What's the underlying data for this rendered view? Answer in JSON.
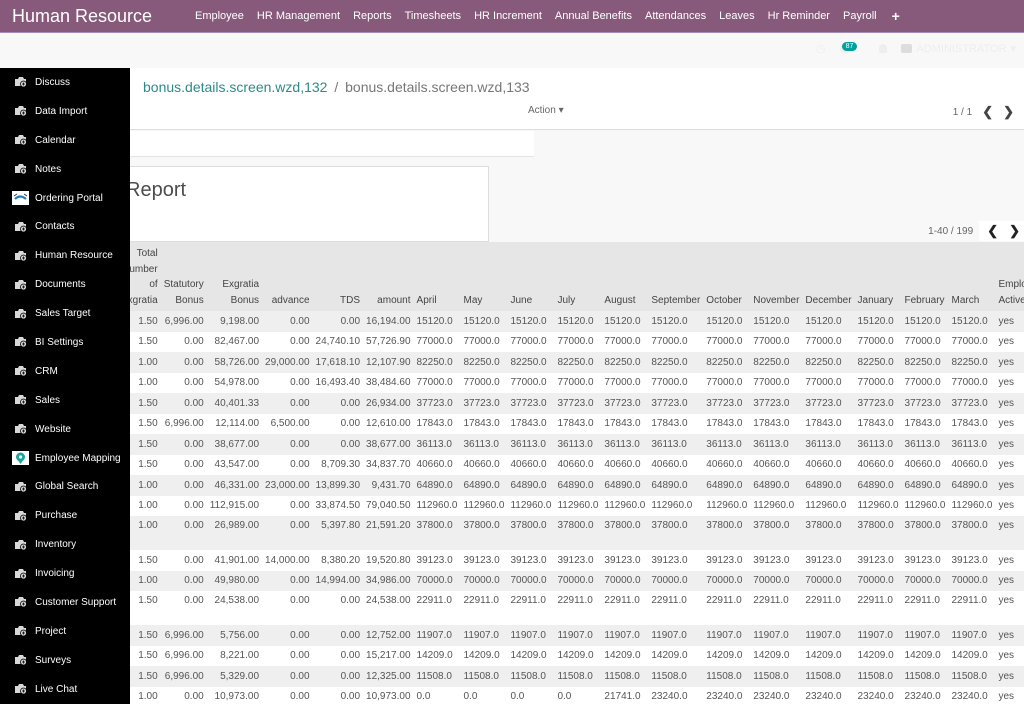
{
  "app": {
    "brand": "Human Resource",
    "menu": [
      "Employee",
      "HR Management",
      "Reports",
      "Timesheets",
      "HR Increment",
      "Annual Benefits",
      "Attendances",
      "Leaves",
      "Hr Reminder",
      "Payroll"
    ],
    "plus_icon": "+",
    "systray": {
      "clock_icon": "◷",
      "messages_icon": "💬",
      "message_count": "87",
      "bell_icon": "🔔",
      "user_name": "ADMINISTRATOR",
      "caret": "▾"
    }
  },
  "sidebar": {
    "items": [
      {
        "label": "Discuss",
        "icon": "default-app-icon"
      },
      {
        "label": "Data Import",
        "icon": "default-app-icon"
      },
      {
        "label": "Calendar",
        "icon": "default-app-icon"
      },
      {
        "label": "Notes",
        "icon": "default-app-icon"
      },
      {
        "label": "Ordering Portal",
        "icon": "handshake-icon"
      },
      {
        "label": "Contacts",
        "icon": "default-app-icon"
      },
      {
        "label": "Human Resource",
        "icon": "default-app-icon"
      },
      {
        "label": "Documents",
        "icon": "default-app-icon"
      },
      {
        "label": "Sales Target",
        "icon": "default-app-icon"
      },
      {
        "label": "BI Settings",
        "icon": "default-app-icon"
      },
      {
        "label": "CRM",
        "icon": "default-app-icon"
      },
      {
        "label": "Sales",
        "icon": "default-app-icon"
      },
      {
        "label": "Website",
        "icon": "default-app-icon"
      },
      {
        "label": "Employee Mapping",
        "icon": "map-pin-icon"
      },
      {
        "label": "Global Search",
        "icon": "default-app-icon"
      },
      {
        "label": "Purchase",
        "icon": "default-app-icon"
      },
      {
        "label": "Inventory",
        "icon": "default-app-icon"
      },
      {
        "label": "Invoicing",
        "icon": "default-app-icon"
      },
      {
        "label": "Customer Support",
        "icon": "default-app-icon"
      },
      {
        "label": "Project",
        "icon": "default-app-icon"
      },
      {
        "label": "Surveys",
        "icon": "default-app-icon"
      },
      {
        "label": "Live Chat",
        "icon": "default-app-icon"
      }
    ]
  },
  "control_panel": {
    "breadcrumb_link": "bonus.details.screen.wzd,132",
    "breadcrumb_sep": "/",
    "breadcrumb_current": "bonus.details.screen.wzd,133",
    "action_label": "Action ▾",
    "pager": "1 / 1",
    "prev": "❮",
    "next": "❯"
  },
  "sheet": {
    "title": "Report"
  },
  "list": {
    "pager": "1-40 / 199",
    "prev": "❮",
    "next": "❯",
    "columns": [
      {
        "label": "Total\nNumber\nof\nExgratia",
        "align": "num"
      },
      {
        "label": "Statutory\nBonus",
        "align": "num"
      },
      {
        "label": "Exgratia\nBonus",
        "align": "num"
      },
      {
        "label": "advance",
        "align": "num"
      },
      {
        "label": "TDS",
        "align": "num"
      },
      {
        "label": "amount",
        "align": "num"
      },
      {
        "label": "April",
        "align": "txt"
      },
      {
        "label": "May",
        "align": "txt"
      },
      {
        "label": "June",
        "align": "txt"
      },
      {
        "label": "July",
        "align": "txt"
      },
      {
        "label": "August",
        "align": "txt"
      },
      {
        "label": "September",
        "align": "txt"
      },
      {
        "label": "October",
        "align": "txt"
      },
      {
        "label": "November",
        "align": "txt"
      },
      {
        "label": "December",
        "align": "txt"
      },
      {
        "label": "January",
        "align": "txt"
      },
      {
        "label": "February",
        "align": "txt"
      },
      {
        "label": "March",
        "align": "txt"
      },
      {
        "label": "Employee\nActive",
        "align": "txt"
      }
    ],
    "rows": [
      {
        "tall": false,
        "cells": [
          "1.50",
          "6,996.00",
          "9,198.00",
          "0.00",
          "0.00",
          "16,194.00",
          "15120.0",
          "15120.0",
          "15120.0",
          "15120.0",
          "15120.0",
          "15120.0",
          "15120.0",
          "15120.0",
          "15120.0",
          "15120.0",
          "15120.0",
          "15120.0",
          "yes"
        ]
      },
      {
        "tall": false,
        "cells": [
          "1.50",
          "0.00",
          "82,467.00",
          "0.00",
          "24,740.10",
          "57,726.90",
          "77000.0",
          "77000.0",
          "77000.0",
          "77000.0",
          "77000.0",
          "77000.0",
          "77000.0",
          "77000.0",
          "77000.0",
          "77000.0",
          "77000.0",
          "77000.0",
          "yes"
        ]
      },
      {
        "tall": false,
        "cells": [
          "1.00",
          "0.00",
          "58,726.00",
          "29,000.00",
          "17,618.10",
          "12,107.90",
          "82250.0",
          "82250.0",
          "82250.0",
          "82250.0",
          "82250.0",
          "82250.0",
          "82250.0",
          "82250.0",
          "82250.0",
          "82250.0",
          "82250.0",
          "82250.0",
          "yes"
        ]
      },
      {
        "tall": false,
        "cells": [
          "1.00",
          "0.00",
          "54,978.00",
          "0.00",
          "16,493.40",
          "38,484.60",
          "77000.0",
          "77000.0",
          "77000.0",
          "77000.0",
          "77000.0",
          "77000.0",
          "77000.0",
          "77000.0",
          "77000.0",
          "77000.0",
          "77000.0",
          "77000.0",
          "yes"
        ]
      },
      {
        "tall": false,
        "cells": [
          "1.50",
          "0.00",
          "40,401.33",
          "0.00",
          "0.00",
          "26,934.00",
          "37723.0",
          "37723.0",
          "37723.0",
          "37723.0",
          "37723.0",
          "37723.0",
          "37723.0",
          "37723.0",
          "37723.0",
          "37723.0",
          "37723.0",
          "37723.0",
          "yes"
        ]
      },
      {
        "tall": false,
        "cells": [
          "1.50",
          "6,996.00",
          "12,114.00",
          "6,500.00",
          "0.00",
          "12,610.00",
          "17843.0",
          "17843.0",
          "17843.0",
          "17843.0",
          "17843.0",
          "17843.0",
          "17843.0",
          "17843.0",
          "17843.0",
          "17843.0",
          "17843.0",
          "17843.0",
          "yes"
        ]
      },
      {
        "tall": false,
        "cells": [
          "1.50",
          "0.00",
          "38,677.00",
          "0.00",
          "0.00",
          "38,677.00",
          "36113.0",
          "36113.0",
          "36113.0",
          "36113.0",
          "36113.0",
          "36113.0",
          "36113.0",
          "36113.0",
          "36113.0",
          "36113.0",
          "36113.0",
          "36113.0",
          "yes"
        ]
      },
      {
        "tall": false,
        "cells": [
          "1.50",
          "0.00",
          "43,547.00",
          "0.00",
          "8,709.30",
          "34,837.70",
          "40660.0",
          "40660.0",
          "40660.0",
          "40660.0",
          "40660.0",
          "40660.0",
          "40660.0",
          "40660.0",
          "40660.0",
          "40660.0",
          "40660.0",
          "40660.0",
          "yes"
        ]
      },
      {
        "tall": false,
        "cells": [
          "1.00",
          "0.00",
          "46,331.00",
          "23,000.00",
          "13,899.30",
          "9,431.70",
          "64890.0",
          "64890.0",
          "64890.0",
          "64890.0",
          "64890.0",
          "64890.0",
          "64890.0",
          "64890.0",
          "64890.0",
          "64890.0",
          "64890.0",
          "64890.0",
          "yes"
        ]
      },
      {
        "tall": false,
        "cells": [
          "1.00",
          "0.00",
          "112,915.00",
          "0.00",
          "33,874.50",
          "79,040.50",
          "112960.0",
          "112960.0",
          "112960.0",
          "112960.0",
          "112960.0",
          "112960.0",
          "112960.0",
          "112960.0",
          "112960.0",
          "112960.0",
          "112960.0",
          "112960.0",
          "yes"
        ]
      },
      {
        "tall": true,
        "cells": [
          "1.00",
          "0.00",
          "26,989.00",
          "0.00",
          "5,397.80",
          "21,591.20",
          "37800.0",
          "37800.0",
          "37800.0",
          "37800.0",
          "37800.0",
          "37800.0",
          "37800.0",
          "37800.0",
          "37800.0",
          "37800.0",
          "37800.0",
          "37800.0",
          "yes"
        ]
      },
      {
        "tall": false,
        "cells": [
          "1.50",
          "0.00",
          "41,901.00",
          "14,000.00",
          "8,380.20",
          "19,520.80",
          "39123.0",
          "39123.0",
          "39123.0",
          "39123.0",
          "39123.0",
          "39123.0",
          "39123.0",
          "39123.0",
          "39123.0",
          "39123.0",
          "39123.0",
          "39123.0",
          "yes"
        ]
      },
      {
        "tall": false,
        "cells": [
          "1.00",
          "0.00",
          "49,980.00",
          "0.00",
          "14,994.00",
          "34,986.00",
          "70000.0",
          "70000.0",
          "70000.0",
          "70000.0",
          "70000.0",
          "70000.0",
          "70000.0",
          "70000.0",
          "70000.0",
          "70000.0",
          "70000.0",
          "70000.0",
          "yes"
        ]
      },
      {
        "tall": true,
        "cells": [
          "1.50",
          "0.00",
          "24,538.00",
          "0.00",
          "0.00",
          "24,538.00",
          "22911.0",
          "22911.0",
          "22911.0",
          "22911.0",
          "22911.0",
          "22911.0",
          "22911.0",
          "22911.0",
          "22911.0",
          "22911.0",
          "22911.0",
          "22911.0",
          "yes"
        ]
      },
      {
        "tall": false,
        "cells": [
          "1.50",
          "6,996.00",
          "5,756.00",
          "0.00",
          "0.00",
          "12,752.00",
          "11907.0",
          "11907.0",
          "11907.0",
          "11907.0",
          "11907.0",
          "11907.0",
          "11907.0",
          "11907.0",
          "11907.0",
          "11907.0",
          "11907.0",
          "11907.0",
          "yes"
        ]
      },
      {
        "tall": false,
        "cells": [
          "1.50",
          "6,996.00",
          "8,221.00",
          "0.00",
          "0.00",
          "15,217.00",
          "14209.0",
          "14209.0",
          "14209.0",
          "14209.0",
          "14209.0",
          "14209.0",
          "14209.0",
          "14209.0",
          "14209.0",
          "14209.0",
          "14209.0",
          "14209.0",
          "yes"
        ]
      },
      {
        "tall": false,
        "cells": [
          "1.50",
          "6,996.00",
          "5,329.00",
          "0.00",
          "0.00",
          "12,325.00",
          "11508.0",
          "11508.0",
          "11508.0",
          "11508.0",
          "11508.0",
          "11508.0",
          "11508.0",
          "11508.0",
          "11508.0",
          "11508.0",
          "11508.0",
          "11508.0",
          "yes"
        ]
      },
      {
        "tall": false,
        "cells": [
          "1.00",
          "0.00",
          "10,973.00",
          "0.00",
          "0.00",
          "10,973.00",
          "0.0",
          "0.0",
          "0.0",
          "0.0",
          "21741.0",
          "23240.0",
          "23240.0",
          "23240.0",
          "23240.0",
          "23240.0",
          "23240.0",
          "23240.0",
          "yes"
        ]
      }
    ]
  },
  "colors": {
    "topbar": "#875a7b",
    "link": "#2c8b8a",
    "badge": "#00a09d",
    "sidebar": "#000000"
  }
}
